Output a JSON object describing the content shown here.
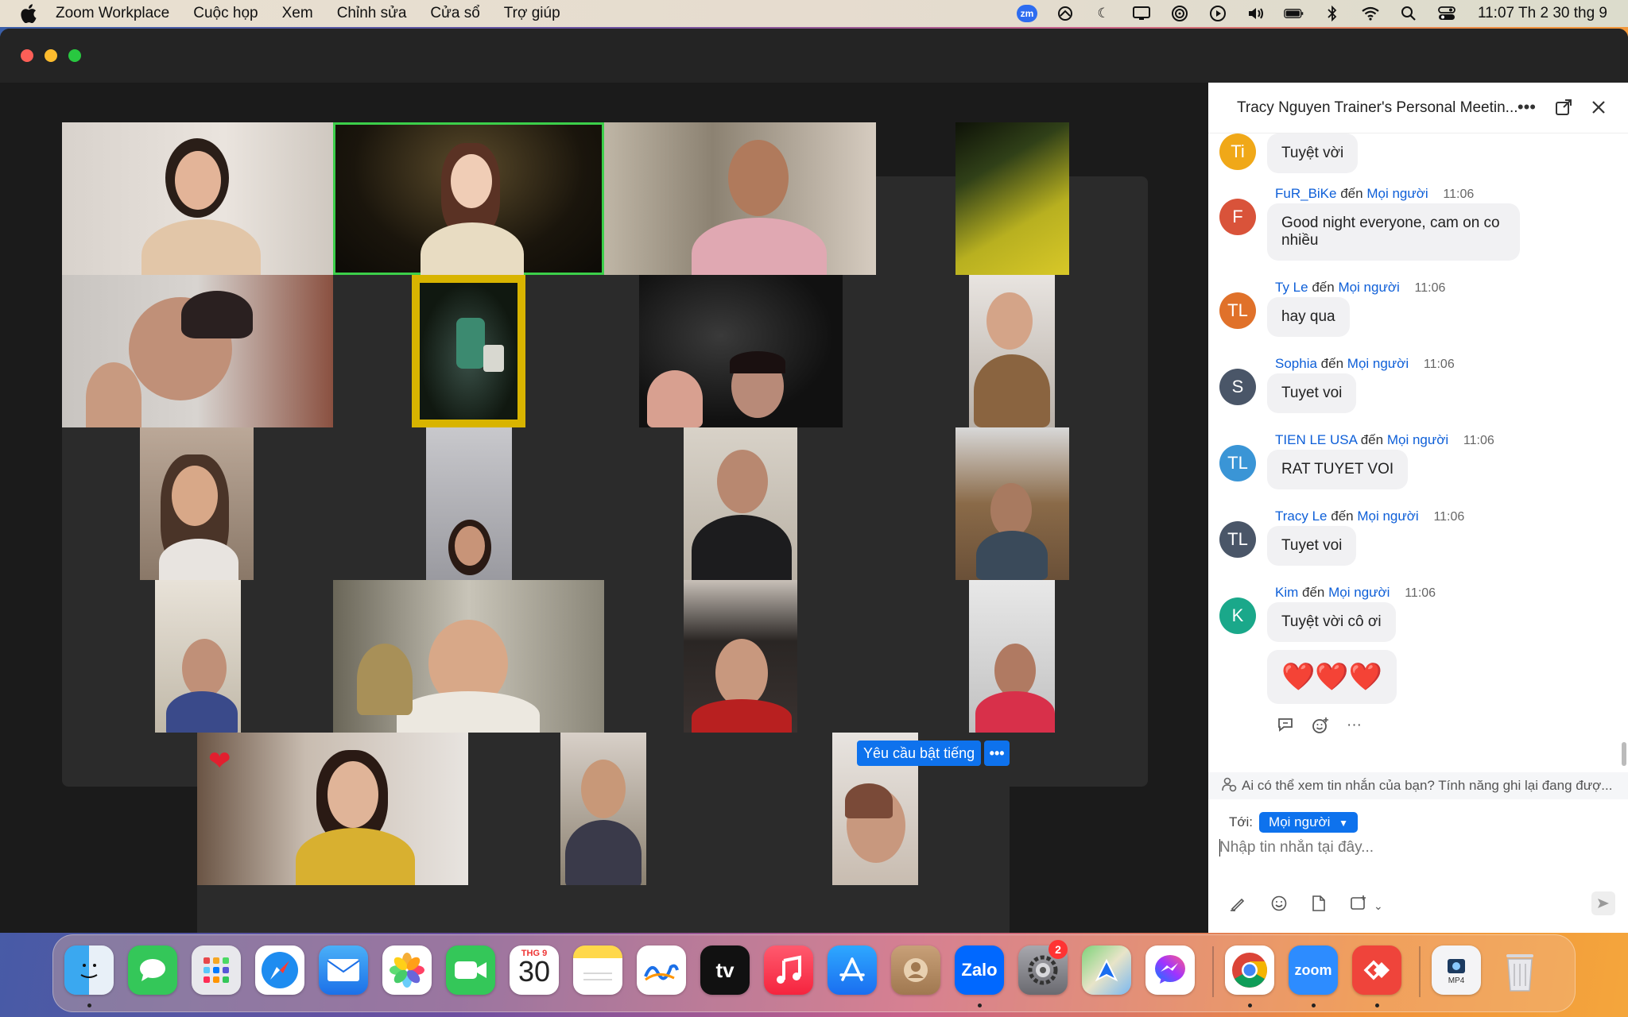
{
  "menubar": {
    "app_name": "Zoom Workplace",
    "items": [
      "Cuộc họp",
      "Xem",
      "Chỉnh sửa",
      "Cửa sổ",
      "Trợ giúp"
    ],
    "zoom_badge": "zm",
    "clock": "11:07 Th 2 30 thg 9"
  },
  "chat": {
    "title": "Tracy Nguyen Trainer's Personal Meetin...",
    "first_bubble": "Tuyệt vời",
    "first_avatar": "Ti",
    "messages": [
      {
        "avatar": "F",
        "color": "#d9533a",
        "sender": "FuR_BiKe",
        "to_word": "đến",
        "to": "Mọi người",
        "time": "11:06",
        "text": "Good night everyone, cam on co nhiều"
      },
      {
        "avatar": "TL",
        "color": "#e0712a",
        "sender": "Ty Le",
        "to_word": "đến",
        "to": "Mọi người",
        "time": "11:06",
        "text": "hay qua"
      },
      {
        "avatar": "S",
        "color": "#4a5668",
        "sender": "Sophia",
        "to_word": "đến",
        "to": "Mọi người",
        "time": "11:06",
        "text": "Tuyet voi"
      },
      {
        "avatar": "TL",
        "color": "#3a95d6",
        "sender": "TIEN LE USA",
        "to_word": "đến",
        "to": "Mọi người",
        "time": "11:06",
        "text": "RAT TUYET VOI"
      },
      {
        "avatar": "TL",
        "color": "#4a5668",
        "sender": "Tracy Le",
        "to_word": "đến",
        "to": "Mọi người",
        "time": "11:06",
        "text": "Tuyet voi"
      },
      {
        "avatar": "K",
        "color": "#1aa88a",
        "sender": "Kim",
        "to_word": "đến",
        "to": "Mọi người",
        "time": "11:06",
        "text": "Tuyệt vời cô ơi"
      }
    ],
    "hearts": "❤️❤️❤️",
    "notice": "Ai có thể xem tin nhắn của bạn? Tính năng ghi lại đang đượ...",
    "to_label": "Tới:",
    "to_value": "Mọi người",
    "input_placeholder": "Nhập tin nhắn tại đây..."
  },
  "gallery": {
    "unmute_request": "Yêu cầu bật tiếng",
    "unmute_more": "•••"
  },
  "dock": {
    "calendar_month": "THG 9",
    "calendar_day": "30",
    "settings_badge": "2",
    "apps": [
      "Finder",
      "Messages",
      "Launchpad",
      "Safari",
      "Mail",
      "Photos",
      "FaceTime",
      "Calendar",
      "Notes",
      "Freeform",
      "TV",
      "Music",
      "App Store",
      "Contacts",
      "Zalo",
      "System Settings",
      "Maps",
      "Messenger",
      "Chrome",
      "Zoom",
      "AnyDesk",
      "MP4 file",
      "Trash"
    ],
    "zalo_label": "Zalo",
    "zoom_label": "zoom",
    "tv_label": "tv",
    "mp4_label": "MP4"
  }
}
